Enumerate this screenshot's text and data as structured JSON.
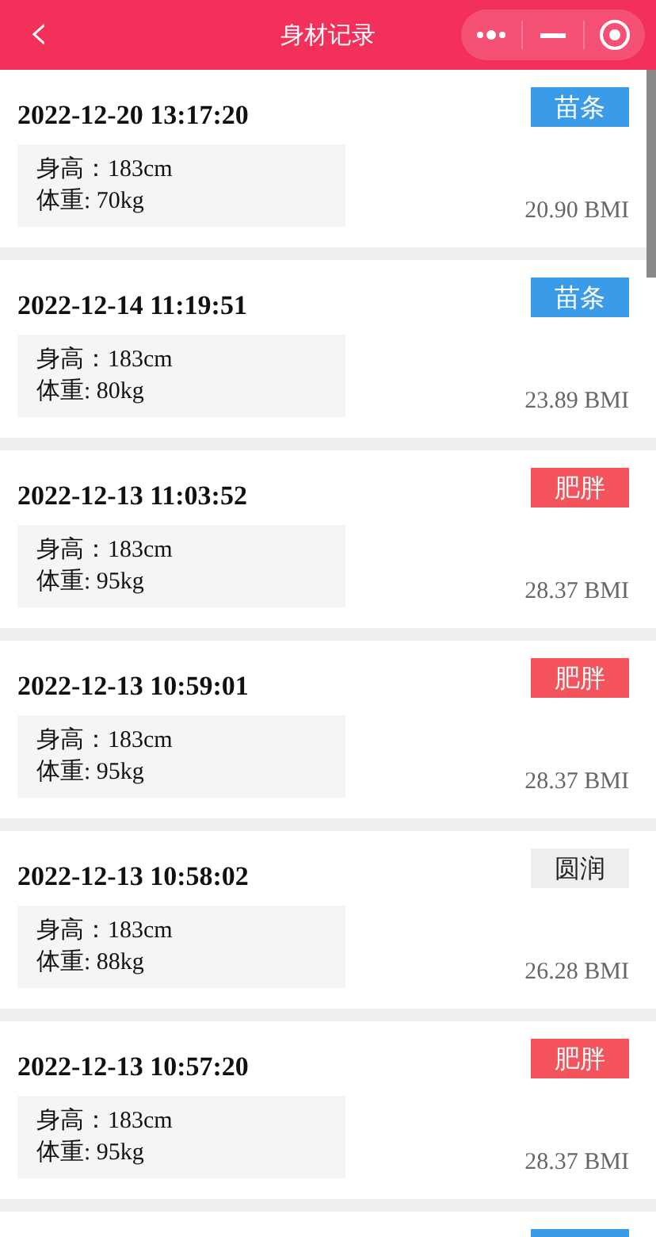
{
  "header": {
    "back_icon": "‹",
    "title": "身材记录"
  },
  "records": [
    {
      "time": "2022-12-20 13:17:20",
      "tag": {
        "kind": "slim",
        "label": "苗条"
      },
      "height": "身高：183cm",
      "weight": "体重: 70kg",
      "bmi": "20.90 BMI"
    },
    {
      "time": "2022-12-14 11:19:51",
      "tag": {
        "kind": "slim",
        "label": "苗条"
      },
      "height": "身高：183cm",
      "weight": "体重: 80kg",
      "bmi": "23.89 BMI"
    },
    {
      "time": "2022-12-13 11:03:52",
      "tag": {
        "kind": "fat",
        "label": "肥胖"
      },
      "height": "身高：183cm",
      "weight": "体重: 95kg",
      "bmi": "28.37 BMI"
    },
    {
      "time": "2022-12-13 10:59:01",
      "tag": {
        "kind": "fat",
        "label": "肥胖"
      },
      "height": "身高：183cm",
      "weight": "体重: 95kg",
      "bmi": "28.37 BMI"
    },
    {
      "time": "2022-12-13 10:58:02",
      "tag": {
        "kind": "round",
        "label": "圆润"
      },
      "height": "身高：183cm",
      "weight": "体重: 88kg",
      "bmi": "26.28 BMI"
    },
    {
      "time": "2022-12-13 10:57:20",
      "tag": {
        "kind": "fat",
        "label": "肥胖"
      },
      "height": "身高：183cm",
      "weight": "体重: 95kg",
      "bmi": "28.37 BMI"
    },
    {
      "tag": {
        "kind": "slim"
      }
    }
  ]
}
